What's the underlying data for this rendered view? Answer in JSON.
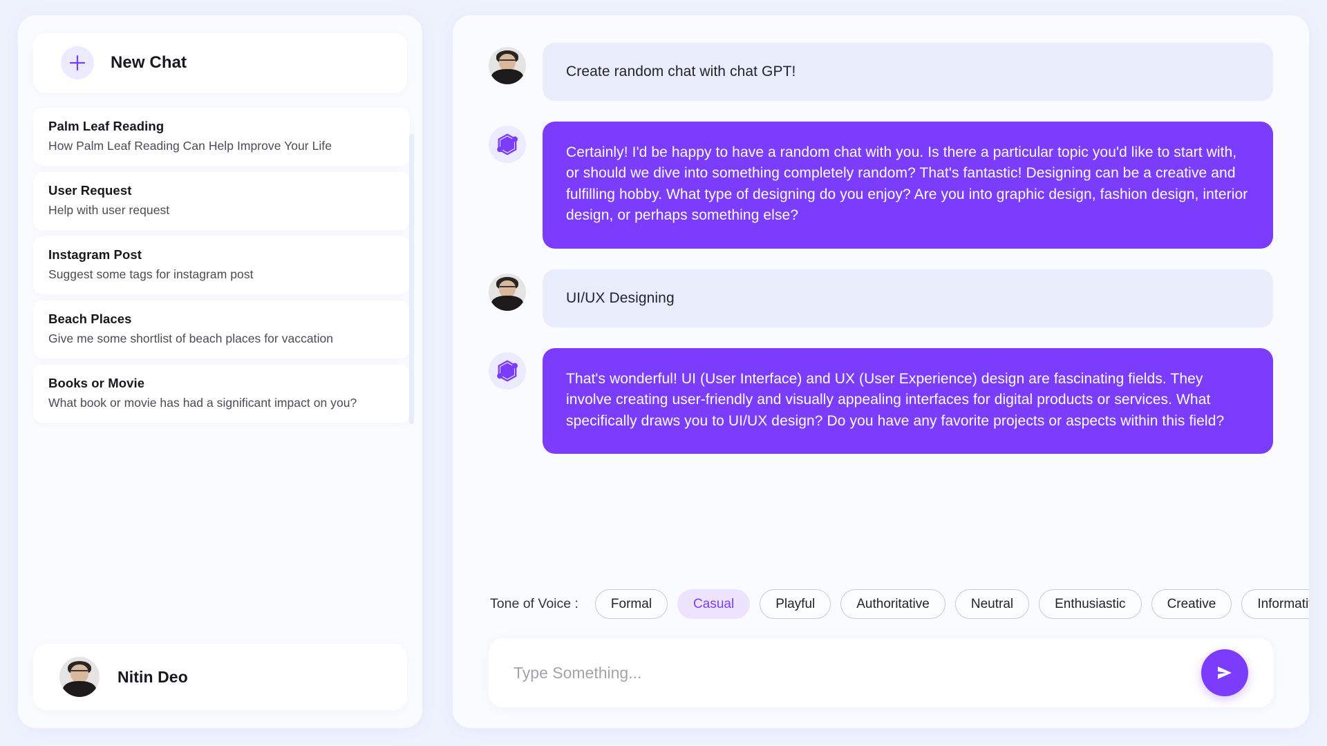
{
  "theme": {
    "page_bg": "#eef2fd",
    "panel_bg": "#fafbff",
    "accent": "#7b3dfb",
    "accent_soft": "#eee3ff",
    "user_bubble": "#e9edfb"
  },
  "sidebar": {
    "new_chat": {
      "label": "New Chat",
      "icon": "plus-icon"
    },
    "chats": [
      {
        "title": "Palm Leaf Reading",
        "subtitle": "How Palm Leaf Reading Can Help Improve Your Life"
      },
      {
        "title": "User Request",
        "subtitle": "Help with user request"
      },
      {
        "title": "Instagram Post",
        "subtitle": "Suggest some tags for instagram post"
      },
      {
        "title": "Beach Places",
        "subtitle": "Give me some shortlist of beach places for vaccation"
      },
      {
        "title": "Books or Movie",
        "subtitle": "What book or movie has had a significant impact on you?"
      }
    ],
    "profile": {
      "name": "Nitin Deo",
      "avatar": "user-avatar"
    }
  },
  "conversation": {
    "messages": [
      {
        "role": "user",
        "avatar": "user-avatar",
        "text": "Create random chat with chat GPT!"
      },
      {
        "role": "bot",
        "avatar": "bot-hexagon-icon",
        "text": "Certainly! I'd be happy to have a random chat with you. Is there a particular topic you'd like to start with, or should we dive into something completely random? That's fantastic! Designing can be a creative and fulfilling hobby. What type of designing do you enjoy? Are you into graphic design, fashion design, interior design, or perhaps something else?"
      },
      {
        "role": "user",
        "avatar": "user-avatar",
        "text": "UI/UX Designing"
      },
      {
        "role": "bot",
        "avatar": "bot-hexagon-icon",
        "text": "That's wonderful! UI (User Interface) and UX (User Experience) design are fascinating fields. They involve creating user-friendly and visually appealing interfaces for digital products or services. What specifically draws you to UI/UX design? Do you have any favorite projects or aspects within this field?"
      }
    ]
  },
  "tone_of_voice": {
    "label": "Tone of Voice :",
    "selected": "Casual",
    "options": [
      "Formal",
      "Casual",
      "Playful",
      "Authoritative",
      "Neutral",
      "Enthusiastic",
      "Creative",
      "Informative"
    ]
  },
  "composer": {
    "placeholder": "Type Something...",
    "value": "",
    "send_icon": "send-icon"
  }
}
